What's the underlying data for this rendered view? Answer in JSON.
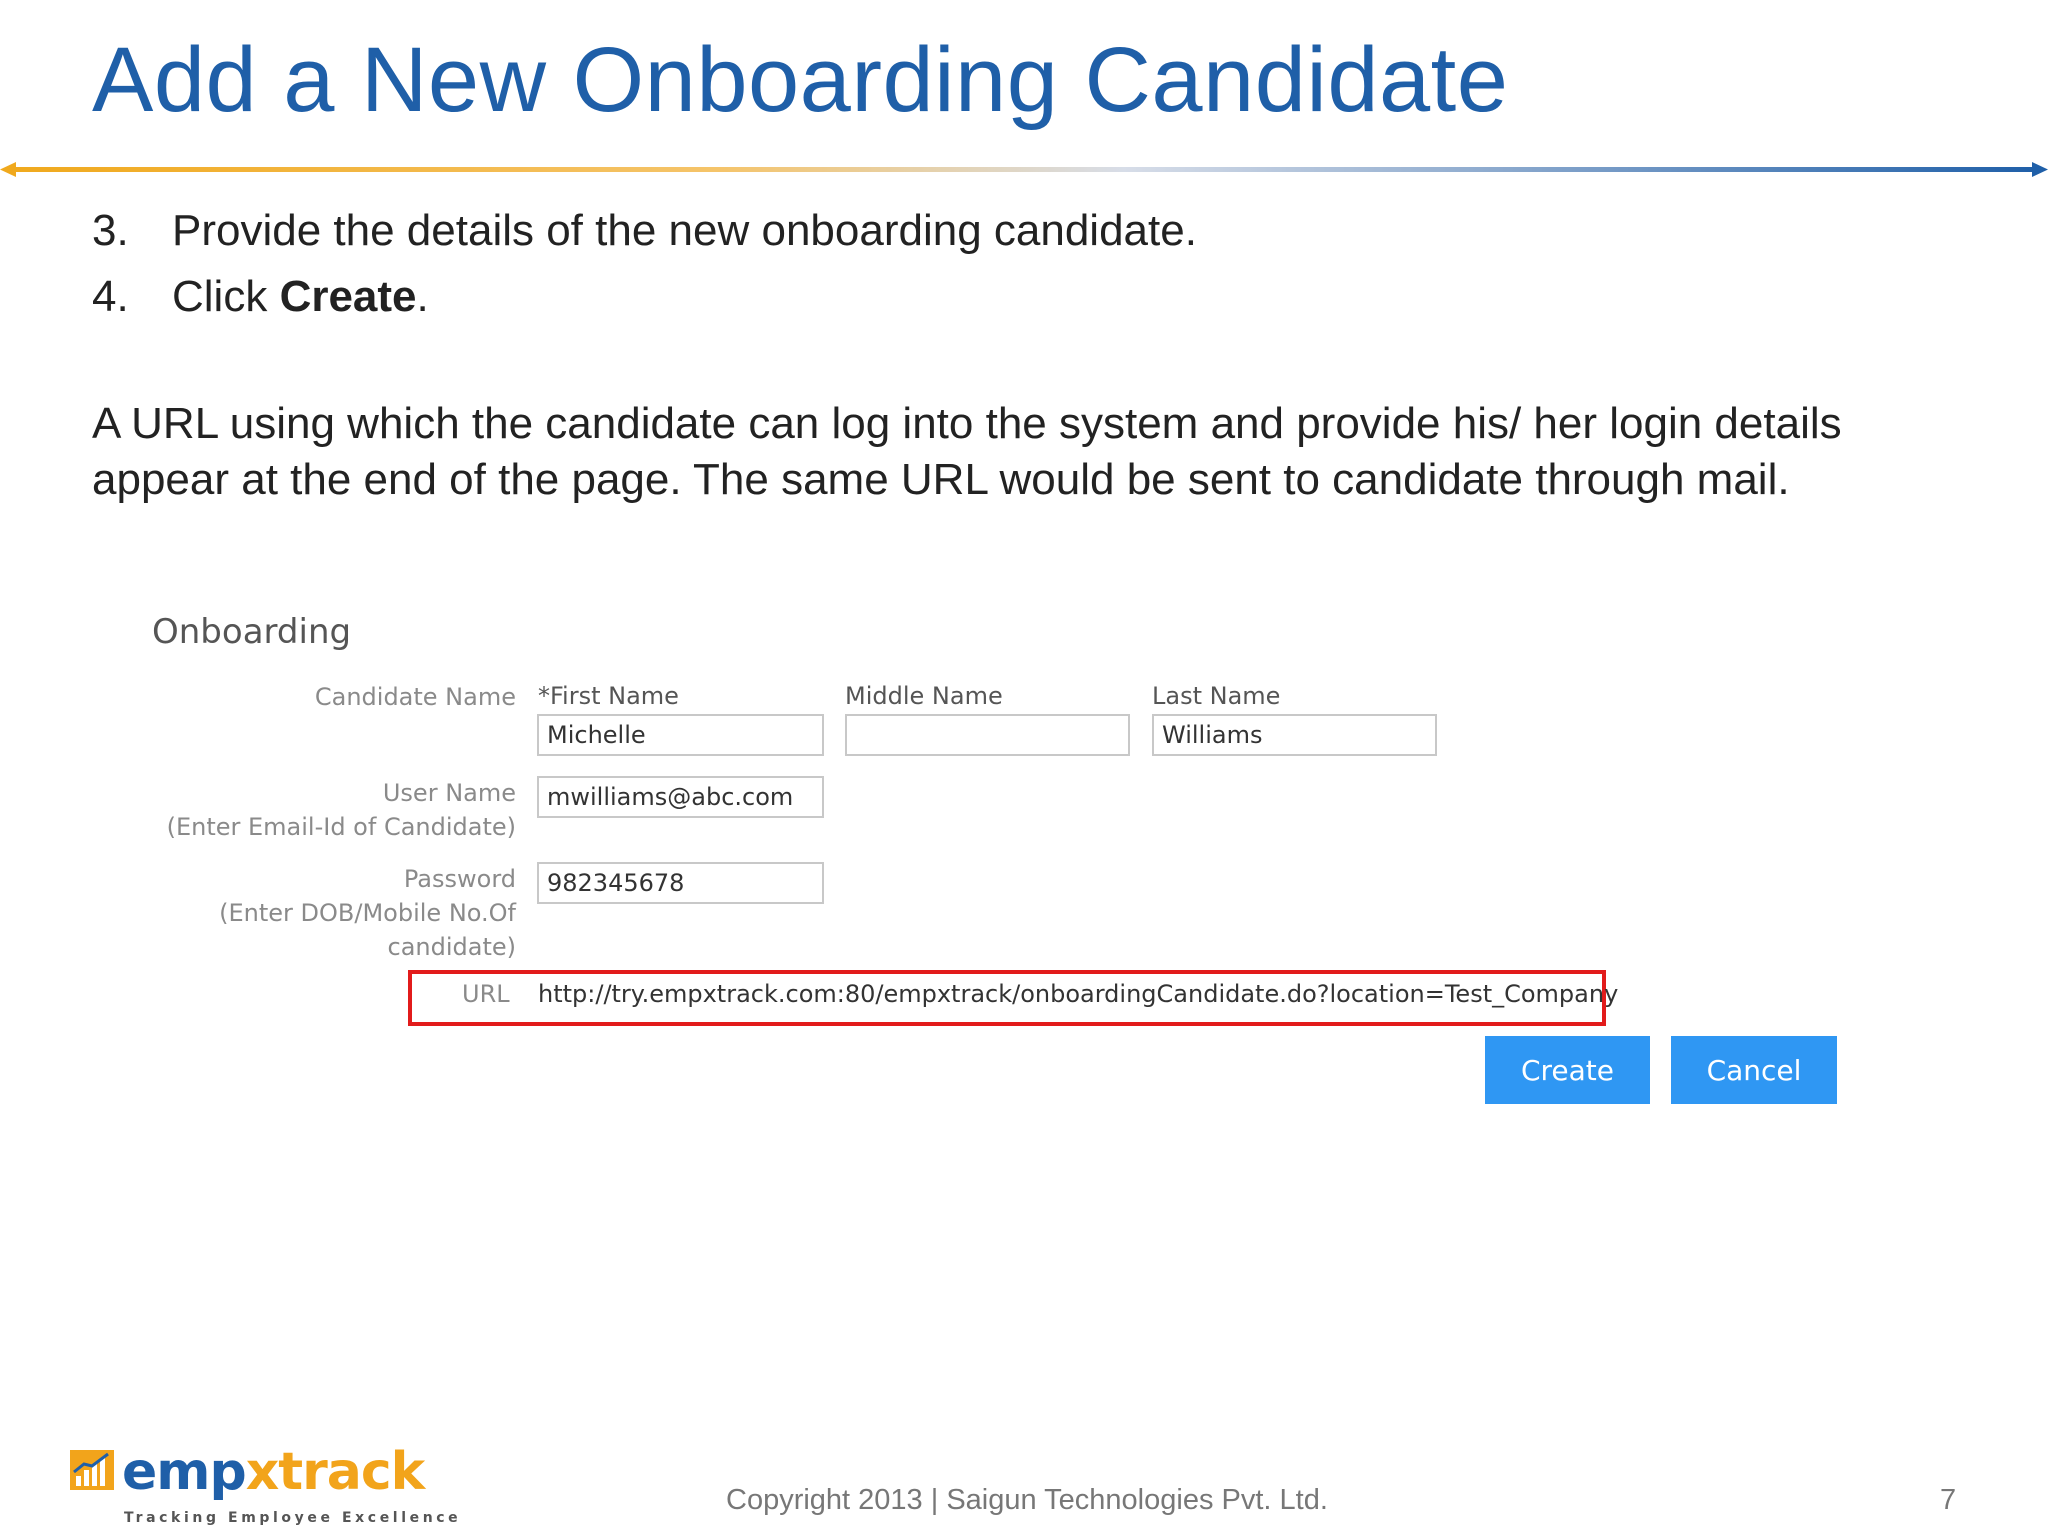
{
  "slide": {
    "title": "Add a New Onboarding Candidate",
    "steps": [
      {
        "num": "3.",
        "text": "Provide the details of the new onboarding candidate."
      },
      {
        "num": "4.",
        "text_before": "Click ",
        "bold": "Create",
        "text_after": "."
      }
    ],
    "paragraph": "A URL using which the candidate can log into the system and provide his/ her login details appear at the end of the page. The same URL would be sent to candidate through mail."
  },
  "form": {
    "section_title": "Onboarding",
    "candidate_name_label": "Candidate Name",
    "first_name_label": "*First Name",
    "middle_name_label": "Middle Name",
    "last_name_label": "Last Name",
    "first_name_value": "Michelle",
    "middle_name_value": "",
    "last_name_value": "Williams",
    "user_name_label": "User Name",
    "user_name_hint": "(Enter Email-Id of Candidate)",
    "user_name_value": "mwilliams@abc.com",
    "password_label": "Password",
    "password_hint_1": "(Enter DOB/Mobile No.Of",
    "password_hint_2": "candidate)",
    "password_value": "982345678",
    "url_label": "URL",
    "url_value": "http://try.empxtrack.com:80/empxtrack/onboardingCandidate.do?location=Test_Company",
    "create_label": "Create",
    "cancel_label": "Cancel",
    "highlight_color": "#e21b1b",
    "button_color": "#2f97f3"
  },
  "footer": {
    "logo_emp": "emp",
    "logo_track": "xtrack",
    "logo_tagline": "Tracking Employee Excellence",
    "copyright": "Copyright 2013 | Saigun Technologies Pvt. Ltd.",
    "page_number": "7"
  },
  "colors": {
    "title": "#1f5fa8",
    "accent_orange": "#f2a41b",
    "accent_blue": "#1f5fa8"
  }
}
